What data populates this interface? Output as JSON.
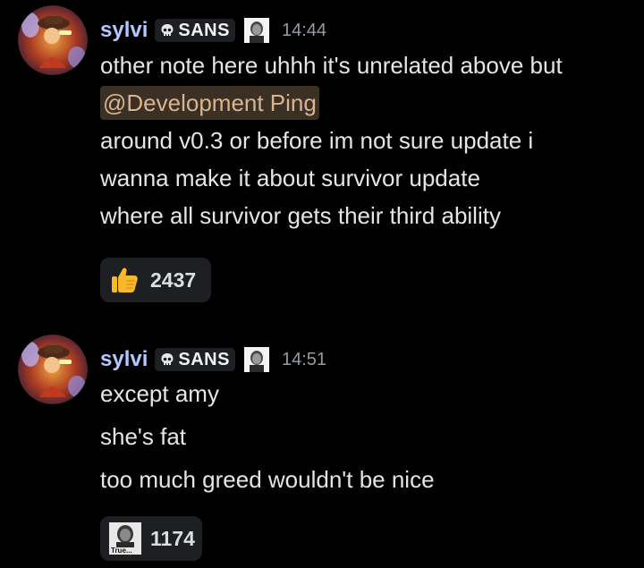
{
  "messages": [
    {
      "username": "sylvi",
      "tag": "SANS",
      "timestamp": "14:44",
      "lines": [
        "other note here uhhh it's unrelated above but",
        "@Development Ping",
        "around v0.3 or before im not sure update i",
        "wanna make it about survivor update",
        "where all survivor gets their third ability"
      ],
      "reaction": {
        "emoji": "thumbs-up",
        "count": "2437"
      }
    },
    {
      "username": "sylvi",
      "tag": "SANS",
      "timestamp": "14:51",
      "lines": [
        "except amy",
        "she's fat",
        "too much greed wouldn't be nice"
      ],
      "reaction": {
        "emoji": "true-meme-image",
        "emoji_text": "True...",
        "count": "1174"
      }
    }
  ],
  "colors": {
    "background": "#000000",
    "username": "#b4c8ff",
    "mention_bg": "#3b3026",
    "mention_text": "#d9b48e",
    "timestamp": "#949ba4",
    "reaction_bg": "#1e1f22"
  }
}
